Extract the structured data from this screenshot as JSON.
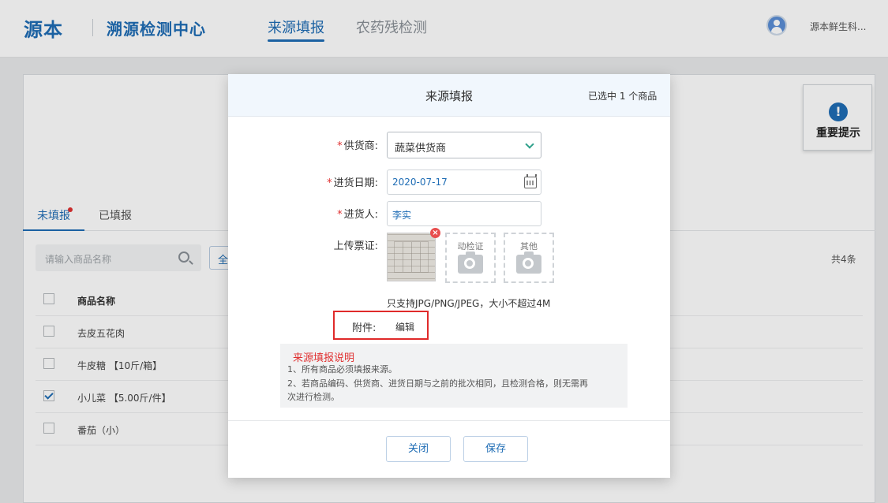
{
  "header": {
    "logo": "源本",
    "subtitle": "溯源检测中心",
    "nav": [
      {
        "label": "来源填报",
        "active": true
      },
      {
        "label": "农药残检测",
        "active": false
      }
    ],
    "user_name": "源本鲜生科..."
  },
  "colors": {
    "brand": "#1f6db5",
    "danger": "#e03131",
    "accent_green": "#2ea08a"
  },
  "tip_card": {
    "label": "重要提示",
    "icon": "exclamation-icon"
  },
  "tabs": [
    {
      "label": "未填报",
      "active": true,
      "badge": true
    },
    {
      "label": "已填报",
      "active": false
    }
  ],
  "search": {
    "placeholder": "请输入商品名称"
  },
  "all_button": {
    "label": "全"
  },
  "total": "共4条",
  "table": {
    "header": "商品名称",
    "rows": [
      {
        "name": "去皮五花肉",
        "checked": false
      },
      {
        "name": "牛皮糖 【10斤/箱】",
        "checked": false
      },
      {
        "name": "小儿菜 【5.00斤/件】",
        "checked": true
      },
      {
        "name": "番茄（小）",
        "checked": false
      }
    ]
  },
  "modal": {
    "title": "来源填报",
    "selected_info": "已选中 1 个商品",
    "fields": {
      "supplier": {
        "label": "供货商:",
        "required": true,
        "value": "蔬菜供货商"
      },
      "date": {
        "label": "进货日期:",
        "required": true,
        "value": "2020-07-17"
      },
      "person": {
        "label": "进货人:",
        "required": true,
        "value": "李实"
      },
      "upload": {
        "label": "上传票证:"
      }
    },
    "upload_slots": [
      {
        "label": "动检证",
        "icon": "camera-icon"
      },
      {
        "label": "其他",
        "icon": "camera-icon"
      }
    ],
    "upload_hint": "只支持JPG/PNG/JPEG，大小不超过4M",
    "attachment": {
      "label": "附件:",
      "action": "编辑"
    },
    "notes": {
      "title": "来源填报说明",
      "lines": [
        "1、所有商品必须填报来源。",
        "2、若商品编码、供货商、进货日期与之前的批次相同，且检测合格，则无需再",
        "次进行检测。"
      ]
    },
    "buttons": {
      "close": "关闭",
      "save": "保存"
    }
  }
}
